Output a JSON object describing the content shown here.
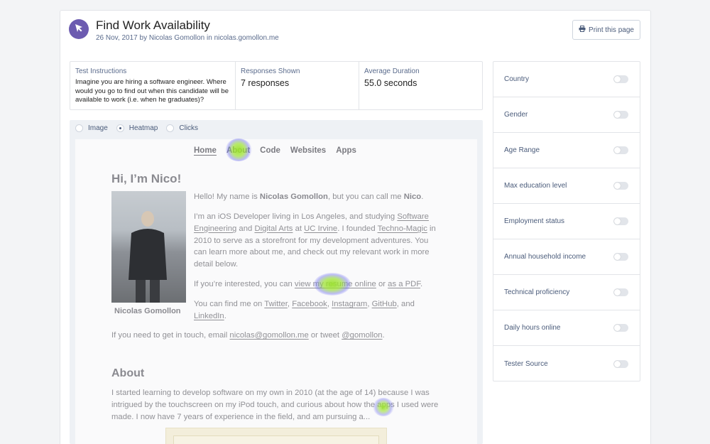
{
  "header": {
    "title": "Find Work Availability",
    "byline": "26 Nov, 2017 by Nicolas Gomollon in nicolas.gomollon.me",
    "print_label": "Print this page"
  },
  "stats": {
    "instructions_label": "Test Instructions",
    "instructions_text": "Imagine you are hiring a software engineer. Where would you go to find out when this candidate will be available to work (i.e. when he graduates)?",
    "responses_label": "Responses Shown",
    "responses_value": "7 responses",
    "duration_label": "Average Duration",
    "duration_value": "55.0 seconds"
  },
  "view_modes": {
    "options": [
      "Image",
      "Heatmap",
      "Clicks"
    ],
    "selected": "Heatmap"
  },
  "site": {
    "nav": [
      "Home",
      "About",
      "Code",
      "Websites",
      "Apps"
    ],
    "heading": "Hi, I’m Nico!",
    "photo_caption": "Nicolas Gomollon",
    "p1_a": "Hello! My name is ",
    "p1_name": "Nicolas Gomollon",
    "p1_b": ", but you can call me ",
    "p1_nick": "Nico",
    "p1_c": ".",
    "p2_a": "I’m an iOS Developer living in Los Angeles, and studying ",
    "p2_link1": "Software Engineering",
    "p2_b": " and ",
    "p2_link2": "Digital Arts",
    "p2_c": " at ",
    "p2_link3": "UC Irvine",
    "p2_d": ". I founded ",
    "p2_link4": "Techno-Magic",
    "p2_e": " in 2010 to serve as a storefront for my development adventures. You can learn more about me, and check out my relevant work in more detail below.",
    "p3_a": "If you’re interested, you can ",
    "p3_link1": "view my resume online",
    "p3_b": " or ",
    "p3_link2": "as a PDF",
    "p3_c": ".",
    "p4_a": "You can find me on ",
    "p4_link1": "Twitter",
    "p4_b": ", ",
    "p4_link2": "Facebook",
    "p4_c": ", ",
    "p4_link3": "Instagram",
    "p4_d": ", ",
    "p4_link4": "GitHub",
    "p4_e": ", and ",
    "p4_link5": "LinkedIn",
    "p4_f": ".",
    "p5_a": "If you need to get in touch, email ",
    "p5_link1": "nicolas@gomollon.me",
    "p5_b": " or tweet ",
    "p5_link2": "@gomollon",
    "p5_c": ".",
    "about_heading": "About",
    "about_text": "I started learning to develop software on my own in 2010 (at the age of 14) because I was intrigued by the touchscreen on my iPod touch, and curious about how the apps I used were made. I now have 7 years of experience in the field, and am pursuing a..."
  },
  "filters": [
    "Country",
    "Gender",
    "Age Range",
    "Max education level",
    "Employment status",
    "Annual household income",
    "Technical proficiency",
    "Daily hours online",
    "Tester Source"
  ],
  "colors": {
    "accent": "#6c5bb0",
    "link_text": "#4a5b7a",
    "heat_core": "#9be22e",
    "heat_edge": "#6f6ff0"
  },
  "icons": {
    "logo": "cursor-arrow-icon",
    "print": "printer-icon"
  }
}
